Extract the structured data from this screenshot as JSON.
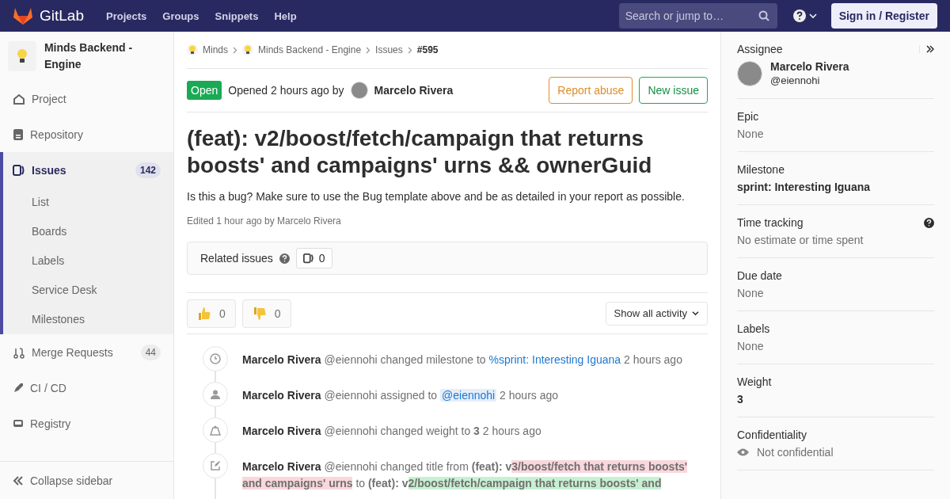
{
  "header": {
    "brand": "GitLab",
    "nav": [
      "Projects",
      "Groups",
      "Snippets",
      "Help"
    ],
    "search": {
      "placeholder": "Search or jump to…"
    },
    "sign_in": "Sign in / Register"
  },
  "sidebar": {
    "project": "Minds Backend - Engine",
    "items": [
      {
        "label": "Project",
        "selected": false
      },
      {
        "label": "Repository",
        "selected": false
      },
      {
        "label": "Issues",
        "selected": true,
        "count": "142",
        "children": [
          {
            "label": "List"
          },
          {
            "label": "Boards"
          },
          {
            "label": "Labels"
          },
          {
            "label": "Service Desk"
          },
          {
            "label": "Milestones"
          }
        ]
      },
      {
        "label": "Merge Requests",
        "selected": false,
        "count": "44"
      },
      {
        "label": "CI / CD",
        "selected": false
      },
      {
        "label": "Registry",
        "selected": false
      }
    ],
    "collapse": "Collapse sidebar"
  },
  "breadcrumbs": [
    {
      "label": "Minds",
      "kind": "group"
    },
    {
      "label": "Minds Backend - Engine",
      "kind": "group"
    },
    {
      "label": "Issues",
      "kind": "plain"
    },
    {
      "label": "#595",
      "kind": "current"
    }
  ],
  "issue": {
    "status": "Open",
    "opened": "Opened 2 hours ago by",
    "author": "Marcelo Rivera",
    "report": "Report abuse",
    "new_issue": "New issue",
    "title": "(feat): v2/boost/fetch/campaign that returns boosts' and campaigns' urns && ownerGuid",
    "description": "Is this a bug? Make sure to use the Bug template above and be as detailed in your report as possible.",
    "edited": "Edited 1 hour ago by Marcelo Rivera",
    "related": {
      "label": "Related issues",
      "count": "0"
    },
    "reactions": [
      {
        "kind": "up",
        "count": "0"
      },
      {
        "kind": "down",
        "count": "0"
      }
    ],
    "filter": "Show all activity"
  },
  "activity": [
    {
      "kind": "clock",
      "parts": [
        {
          "kind": "author",
          "text": "Marcelo Rivera"
        },
        {
          "kind": "text",
          "text": "@eiennohi changed milestone to"
        },
        {
          "kind": "link",
          "text": "%sprint: Interesting Iguana"
        },
        {
          "kind": "text",
          "text": "2 hours ago"
        }
      ]
    },
    {
      "kind": "person",
      "parts": [
        {
          "kind": "author",
          "text": "Marcelo Rivera"
        },
        {
          "kind": "text",
          "text": "@eiennohi assigned to"
        },
        {
          "kind": "mention",
          "text": "@eiennohi"
        },
        {
          "kind": "text",
          "text": "2 hours ago"
        }
      ]
    },
    {
      "kind": "weight",
      "parts": [
        {
          "kind": "author",
          "text": "Marcelo Rivera"
        },
        {
          "kind": "text",
          "text": "@eiennohi changed weight to"
        },
        {
          "kind": "strong",
          "text": "3"
        },
        {
          "kind": "text",
          "text": "2 hours ago"
        }
      ]
    },
    {
      "kind": "edit",
      "parts": [
        {
          "kind": "author",
          "text": "Marcelo Rivera"
        },
        {
          "kind": "text",
          "text": "@eiennohi changed title from"
        },
        {
          "kind": "strong",
          "text": "(feat): v"
        },
        {
          "kind": "removed",
          "text": "3/boost/fetch that returns boosts' and campaigns' urns"
        },
        {
          "kind": "text",
          "text": "to"
        },
        {
          "kind": "strong",
          "text": "(feat): v"
        },
        {
          "kind": "added",
          "text": "2/boost/fetch/campaign that returns boosts' and"
        }
      ]
    }
  ],
  "right": {
    "assignee": {
      "label": "Assignee",
      "name": "Marcelo Rivera",
      "handle": "@eiennohi"
    },
    "sections": [
      {
        "label": "Epic",
        "value": "None",
        "kind": "muted"
      },
      {
        "label": "Milestone",
        "value": "sprint: Interesting Iguana",
        "kind": "strong"
      },
      {
        "label": "Time tracking",
        "value": "No estimate or time spent",
        "kind": "help"
      },
      {
        "label": "Due date",
        "value": "None",
        "kind": "muted"
      },
      {
        "label": "Labels",
        "value": "None",
        "kind": "muted"
      },
      {
        "label": "Weight",
        "value": "3",
        "kind": "strong"
      },
      {
        "label": "Confidentiality",
        "value": "Not confidential",
        "kind": "eye"
      }
    ]
  }
}
